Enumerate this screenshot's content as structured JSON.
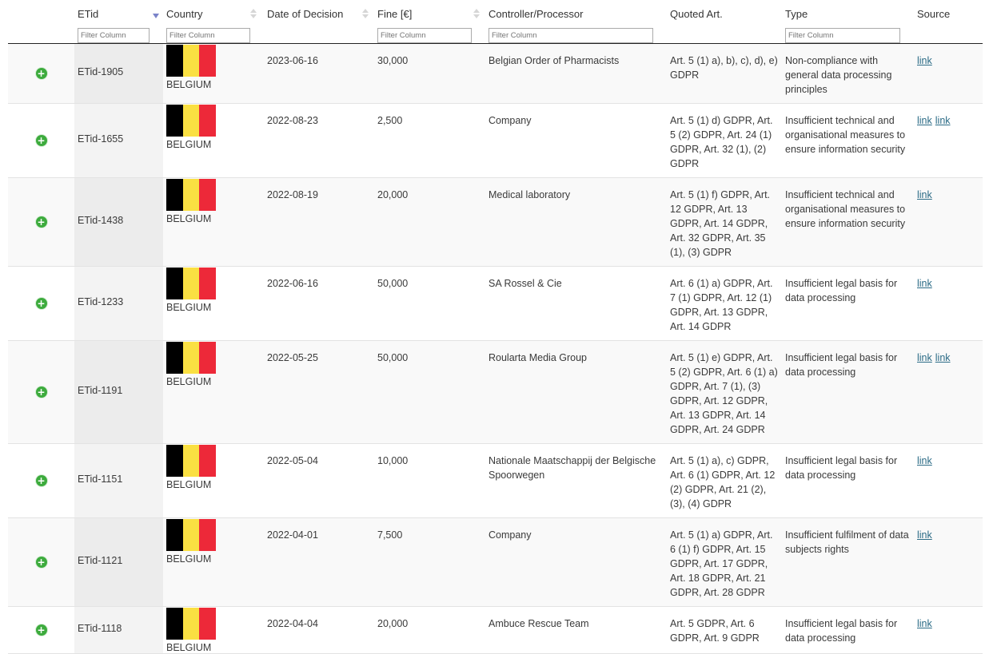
{
  "columns": {
    "etid": "ETid",
    "country": "Country",
    "date": "Date of Decision",
    "fine": "Fine [€]",
    "controller": "Controller/Processor",
    "quoted": "Quoted Art.",
    "type": "Type",
    "source": "Source"
  },
  "filter_placeholder": "Filter Column",
  "sort": {
    "column": "etid",
    "direction": "descending"
  },
  "flag_colors": [
    "#000000",
    "#fae042",
    "#ed2939"
  ],
  "rows": [
    {
      "etid": "ETid-1905",
      "country": "BELGIUM",
      "date": "2023-06-16",
      "fine": "30,000",
      "controller": "Belgian Order of Pharmacists",
      "quoted": "Art. 5 (1) a), b), c), d), e) GDPR",
      "type": "Non-compliance with general data processing principles",
      "links": [
        "link"
      ]
    },
    {
      "etid": "ETid-1655",
      "country": "BELGIUM",
      "date": "2022-08-23",
      "fine": "2,500",
      "controller": "Company",
      "quoted": "Art. 5 (1) d) GDPR, Art. 5 (2) GDPR, Art. 24 (1) GDPR, Art. 32 (1), (2) GDPR",
      "type": "Insufficient technical and organisational measures to ensure information security",
      "links": [
        "link",
        "link"
      ]
    },
    {
      "etid": "ETid-1438",
      "country": "BELGIUM",
      "date": "2022-08-19",
      "fine": "20,000",
      "controller": "Medical laboratory",
      "quoted": "Art. 5 (1) f) GDPR, Art. 12 GDPR, Art. 13 GDPR, Art. 14 GDPR, Art. 32 GDPR, Art. 35 (1), (3) GDPR",
      "type": "Insufficient technical and organisational measures to ensure information security",
      "links": [
        "link"
      ]
    },
    {
      "etid": "ETid-1233",
      "country": "BELGIUM",
      "date": "2022-06-16",
      "fine": "50,000",
      "controller": "SA Rossel & Cie",
      "quoted": "Art. 6 (1) a) GDPR, Art. 7 (1) GDPR, Art. 12 (1) GDPR, Art. 13 GDPR, Art. 14 GDPR",
      "type": "Insufficient legal basis for data processing",
      "links": [
        "link"
      ]
    },
    {
      "etid": "ETid-1191",
      "country": "BELGIUM",
      "date": "2022-05-25",
      "fine": "50,000",
      "controller": "Roularta Media Group",
      "quoted": "Art. 5 (1) e) GDPR, Art. 5 (2) GDPR, Art. 6 (1) a) GDPR, Art. 7 (1), (3) GDPR, Art. 12 GDPR, Art. 13 GDPR, Art. 14 GDPR, Art. 24 GDPR",
      "type": "Insufficient legal basis for data processing",
      "links": [
        "link",
        "link"
      ]
    },
    {
      "etid": "ETid-1151",
      "country": "BELGIUM",
      "date": "2022-05-04",
      "fine": "10,000",
      "controller": "Nationale Maatschappij der Belgische Spoorwegen",
      "quoted": "Art. 5 (1) a), c) GDPR, Art. 6 (1) GDPR, Art. 12 (2) GDPR, Art. 21 (2), (3), (4) GDPR",
      "type": "Insufficient legal basis for data processing",
      "links": [
        "link"
      ]
    },
    {
      "etid": "ETid-1121",
      "country": "BELGIUM",
      "date": "2022-04-01",
      "fine": "7,500",
      "controller": "Company",
      "quoted": "Art. 5 (1) a) GDPR, Art. 6 (1) f) GDPR, Art. 15 GDPR, Art. 17 GDPR, Art. 18 GDPR, Art. 21 GDPR, Art. 28 GDPR",
      "type": "Insufficient fulfilment of data subjects rights",
      "links": [
        "link"
      ]
    },
    {
      "etid": "ETid-1118",
      "country": "BELGIUM",
      "date": "2022-04-04",
      "fine": "20,000",
      "controller": "Ambuce Rescue Team",
      "quoted": "Art. 5 GDPR, Art. 6 GDPR, Art. 9 GDPR",
      "type": "Insufficient legal basis for data processing",
      "links": [
        "link"
      ]
    }
  ]
}
